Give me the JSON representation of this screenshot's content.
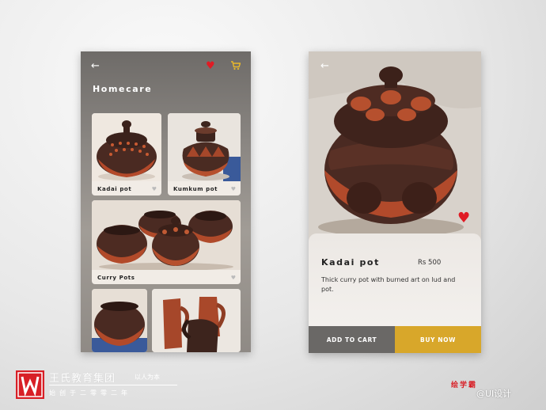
{
  "screen1": {
    "title": "Homecare",
    "icons": {
      "back": "back-arrow-icon",
      "wishlist": "heart-icon",
      "cart": "cart-icon"
    },
    "products": [
      {
        "label": "Kadai pot"
      },
      {
        "label": "Kumkum pot"
      },
      {
        "label": "Curry Pots"
      },
      {
        "label": ""
      },
      {
        "label": ""
      }
    ]
  },
  "screen2": {
    "product_name": "Kadai pot",
    "price": "Rs 500",
    "description": "Thick curry pot with burned art on lud and pot.",
    "add_to_cart_label": "ADD TO CART",
    "buy_now_label": "BUY NOW"
  },
  "branding": {
    "company": "王氏教育集团",
    "tagline": "以人为本",
    "slogan": "始创于二零零二年",
    "right_text": "绘学霸",
    "watermark": "@UI设计"
  },
  "colors": {
    "accent_red": "#e01b24",
    "buy_gold": "#d8a72a",
    "cart_gray": "#6a6866",
    "brand_red": "#d81f26"
  }
}
